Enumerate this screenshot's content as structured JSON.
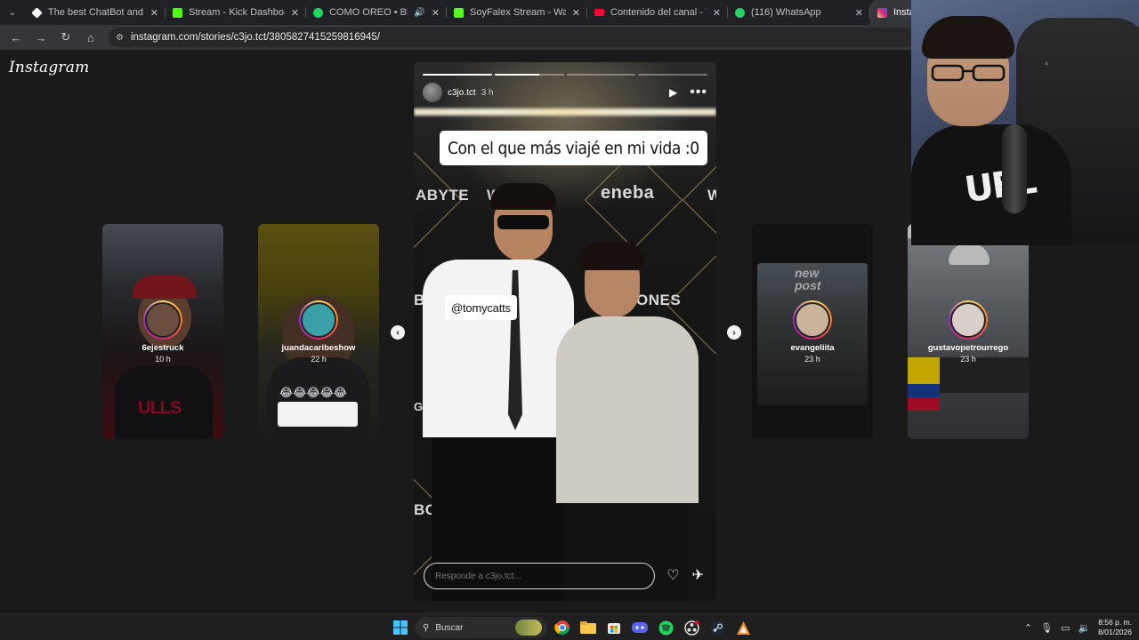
{
  "browser": {
    "tabs": [
      {
        "title": "The best ChatBot and Widgets",
        "fav_color": "#ffffff"
      },
      {
        "title": "Stream - Kick Dashboard",
        "fav_color": "#53fc18"
      },
      {
        "title": "COMO OREO • Blessd, Fue",
        "fav_color": "#1ed760"
      },
      {
        "title": "SoyFalex Stream - Watch Live o",
        "fav_color": "#53fc18"
      },
      {
        "title": "Contenido del canal - YouTube",
        "fav_color": "#ff0033"
      },
      {
        "title": "(116) WhatsApp",
        "fav_color": "#25d366"
      },
      {
        "title": "Instagra",
        "fav_color": "#e1306c"
      }
    ],
    "url": "instagram.com/stories/c3jo.tct/3805827415259816945/"
  },
  "instagram": {
    "logo": "Instagram",
    "story": {
      "username": "c3jo.tct",
      "time": "3 h",
      "caption": "Con el que más viajé en mi vida :0",
      "mention": "@tomycatts",
      "reply_placeholder": "Responde a c3jo.tct...",
      "progress": [
        1,
        0.65,
        0,
        0
      ]
    },
    "side_stories": [
      {
        "username": "6ejestruck",
        "time": "10 h"
      },
      {
        "username": "juandacaribeshow",
        "time": "22 h"
      },
      {
        "username": "evangeliita",
        "time": "23 h"
      },
      {
        "username": "gustavopetrourrego",
        "time": "23 h"
      }
    ],
    "backdrop": {
      "word_1": "ABYTE",
      "word_2": "W",
      "word_3": "eneba",
      "word_4": "W",
      "word_5": "ONES",
      "word_6": "BO",
      "word_7": "GABYTE",
      "word_8": "BC"
    },
    "thumb_text": {
      "poster": "new post",
      "emoji_row": "😂😂😂😂😂"
    }
  },
  "webcam": {
    "shirt_text": "UEL"
  },
  "taskbar": {
    "search_label": "Buscar",
    "time": "8:56 p. m.",
    "date": "8/01/2026"
  }
}
